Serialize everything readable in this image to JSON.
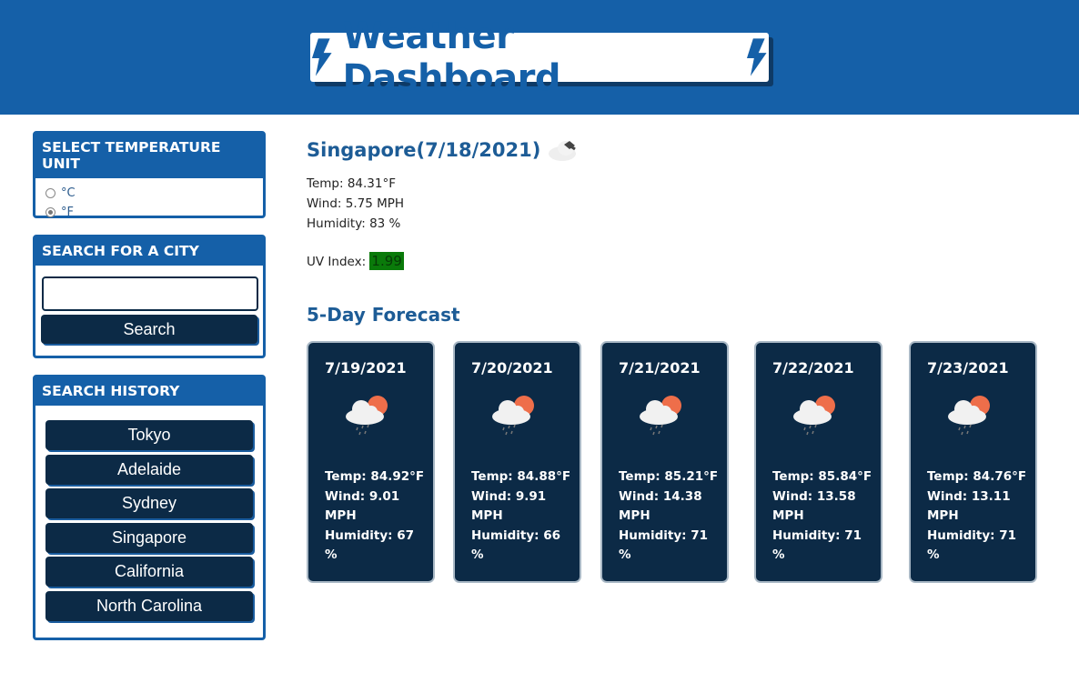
{
  "header": {
    "title": "Weather Dashboard",
    "icon": "lightning-bolt-icon"
  },
  "temperature_unit": {
    "heading": "SELECT TEMPERATURE UNIT",
    "options": [
      {
        "label": "°C",
        "checked": false
      },
      {
        "label": "°F",
        "checked": true
      }
    ]
  },
  "search": {
    "heading": "SEARCH FOR A CITY",
    "input_value": "",
    "placeholder": "",
    "button_label": "Search"
  },
  "history": {
    "heading": "SEARCH HISTORY",
    "items": [
      "Tokyo",
      "Adelaide",
      "Sydney",
      "Singapore",
      "California",
      "North Carolina"
    ]
  },
  "current": {
    "title": "Singapore(7/18/2021)",
    "icon": "cloud-icon",
    "temp": "Temp: 84.31°F",
    "wind": "Wind: 5.75 MPH",
    "humidity": "Humidity: 83 %",
    "uv_label": "UV Index: ",
    "uv_value": "1.99",
    "uv_color": "#0a7a0a"
  },
  "forecast": {
    "heading": "5-Day Forecast",
    "days": [
      {
        "date": "7/19/2021",
        "icon": "rain-sun-cloud-icon",
        "temp": "Temp: 84.92°F",
        "wind": "Wind: 9.01 MPH",
        "humidity": "Humidity: 67 %"
      },
      {
        "date": "7/20/2021",
        "icon": "rain-sun-cloud-icon",
        "temp": "Temp: 84.88°F",
        "wind": "Wind: 9.91 MPH",
        "humidity": "Humidity: 66 %"
      },
      {
        "date": "7/21/2021",
        "icon": "rain-sun-cloud-icon",
        "temp": "Temp: 85.21°F",
        "wind": "Wind: 14.38 MPH",
        "humidity": "Humidity: 71 %"
      },
      {
        "date": "7/22/2021",
        "icon": "rain-sun-cloud-icon",
        "temp": "Temp: 85.84°F",
        "wind": "Wind: 13.58 MPH",
        "humidity": "Humidity: 71 %"
      },
      {
        "date": "7/23/2021",
        "icon": "rain-sun-cloud-icon",
        "temp": "Temp: 84.76°F",
        "wind": "Wind: 13.11 MPH",
        "humidity": "Humidity: 71 %"
      }
    ]
  },
  "colors": {
    "primary": "#1560a8",
    "dark": "#0c2a46",
    "sun": "#ee6e4a"
  }
}
